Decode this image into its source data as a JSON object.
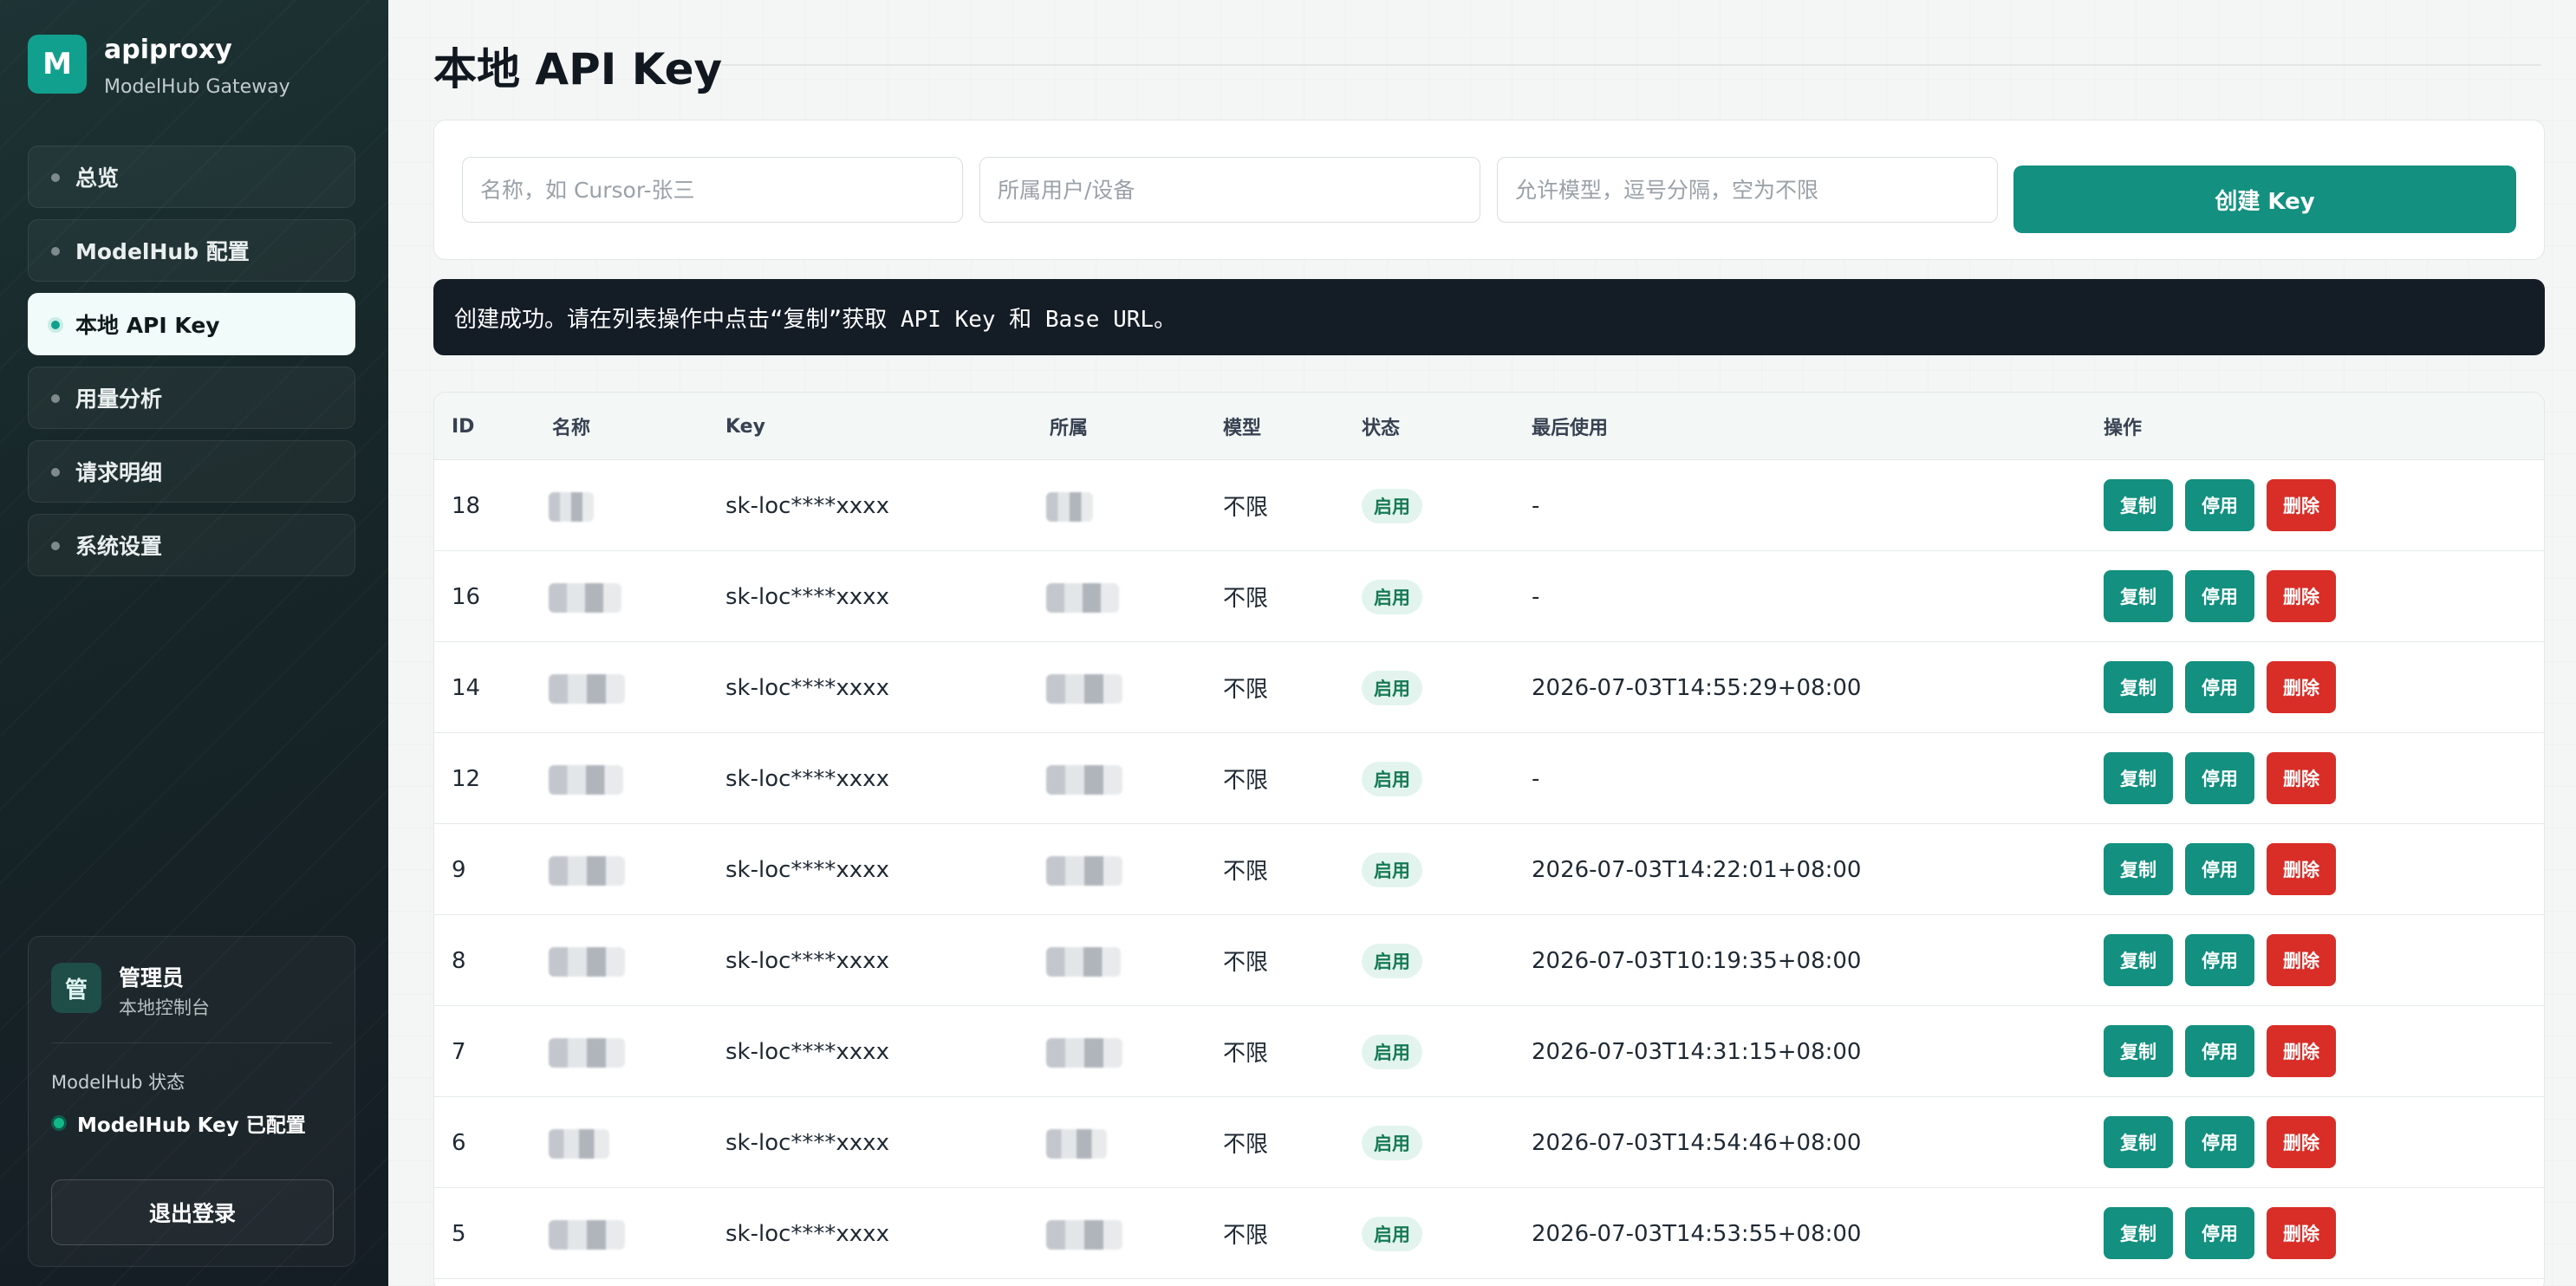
{
  "brand": {
    "logo_letter": "M",
    "name": "apiproxy",
    "subtitle": "ModelHub Gateway"
  },
  "nav": {
    "items": [
      {
        "label": "总览"
      },
      {
        "label": "ModelHub 配置"
      },
      {
        "label": "本地 API Key",
        "active": true
      },
      {
        "label": "用量分析"
      },
      {
        "label": "请求明细"
      },
      {
        "label": "系统设置"
      }
    ]
  },
  "admin": {
    "avatar": "管",
    "name": "管理员",
    "role": "本地控制台",
    "status_label": "ModelHub 状态",
    "status_text": "ModelHub Key 已配置",
    "logout_label": "退出登录"
  },
  "page": {
    "title": "本地 API Key"
  },
  "form": {
    "name_placeholder": "名称，如 Cursor-张三",
    "owner_placeholder": "所属用户/设备",
    "models_placeholder": "允许模型，逗号分隔，空为不限",
    "create_label": "创建 Key"
  },
  "alert": {
    "text": "创建成功。请在列表操作中点击“复制”获取 API Key 和 Base URL。"
  },
  "table": {
    "headers": {
      "id": "ID",
      "name": "名称",
      "key": "Key",
      "owner": "所属",
      "model": "模型",
      "status": "状态",
      "last_used": "最后使用",
      "actions": "操作"
    },
    "action_labels": {
      "copy": "复制",
      "disable": "停用",
      "delete": "删除"
    },
    "rows": [
      {
        "id": "18",
        "key": "sk-loc****xxxx",
        "model": "不限",
        "status": "启用",
        "last_used": "-"
      },
      {
        "id": "16",
        "key": "sk-loc****xxxx",
        "model": "不限",
        "status": "启用",
        "last_used": "-"
      },
      {
        "id": "14",
        "key": "sk-loc****xxxx",
        "model": "不限",
        "status": "启用",
        "last_used": "2026-07-03T14:55:29+08:00"
      },
      {
        "id": "12",
        "key": "sk-loc****xxxx",
        "model": "不限",
        "status": "启用",
        "last_used": "-"
      },
      {
        "id": "9",
        "key": "sk-loc****xxxx",
        "model": "不限",
        "status": "启用",
        "last_used": "2026-07-03T14:22:01+08:00"
      },
      {
        "id": "8",
        "key": "sk-loc****xxxx",
        "model": "不限",
        "status": "启用",
        "last_used": "2026-07-03T10:19:35+08:00"
      },
      {
        "id": "7",
        "key": "sk-loc****xxxx",
        "model": "不限",
        "status": "启用",
        "last_used": "2026-07-03T14:31:15+08:00"
      },
      {
        "id": "6",
        "key": "sk-loc****xxxx",
        "model": "不限",
        "status": "启用",
        "last_used": "2026-07-03T14:54:46+08:00"
      },
      {
        "id": "5",
        "key": "sk-loc****xxxx",
        "model": "不限",
        "status": "启用",
        "last_used": "2026-07-03T14:53:55+08:00"
      }
    ]
  },
  "colors": {
    "accent": "#13907f",
    "danger": "#d92d27",
    "sidebar_bg": "#172628",
    "status_green": "#12b886"
  }
}
